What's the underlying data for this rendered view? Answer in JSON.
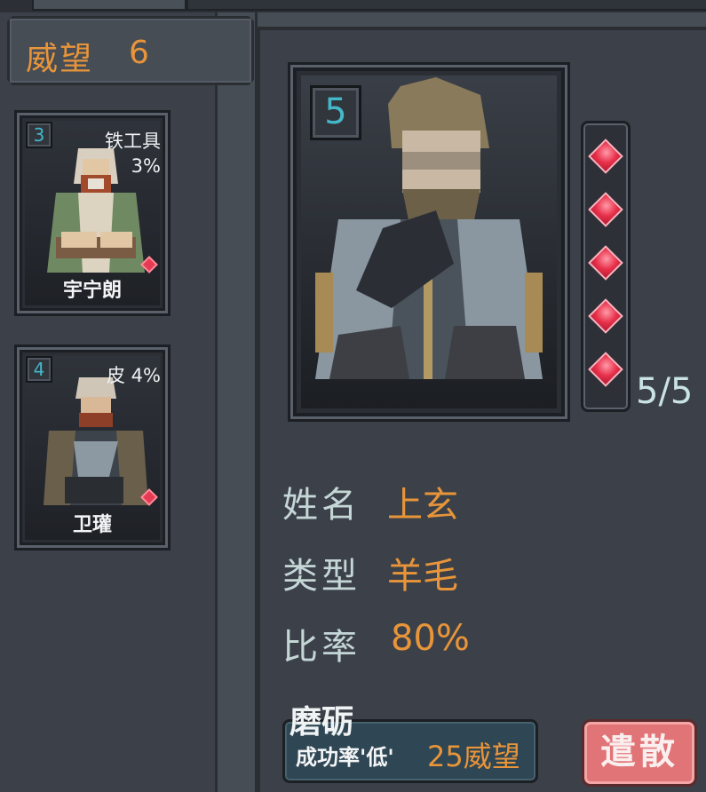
{
  "prestige": {
    "label": "威望",
    "value": "6"
  },
  "candidates": [
    {
      "level": "3",
      "skill": "铁工具",
      "skill_rate": "3%",
      "name": "宇宁朗"
    },
    {
      "level": "4",
      "skill": "皮 4%",
      "name": "卫瓘"
    }
  ],
  "selected": {
    "level": "5",
    "gem_count": "5/5",
    "gems_filled": 5,
    "gems_total": 5,
    "rows": [
      {
        "label": "姓名",
        "value": "上玄"
      },
      {
        "label": "类型",
        "value": "羊毛"
      },
      {
        "label": "比率",
        "value": "80%"
      }
    ]
  },
  "hone": {
    "title": "磨砺",
    "rate_label": "成功率'低'",
    "cost": "25威望"
  },
  "dismiss_label": "遣散",
  "colors": {
    "accent": "#e8953a",
    "gem": "#e8304a",
    "level": "#44b7c9",
    "dismiss": "#e07476"
  }
}
